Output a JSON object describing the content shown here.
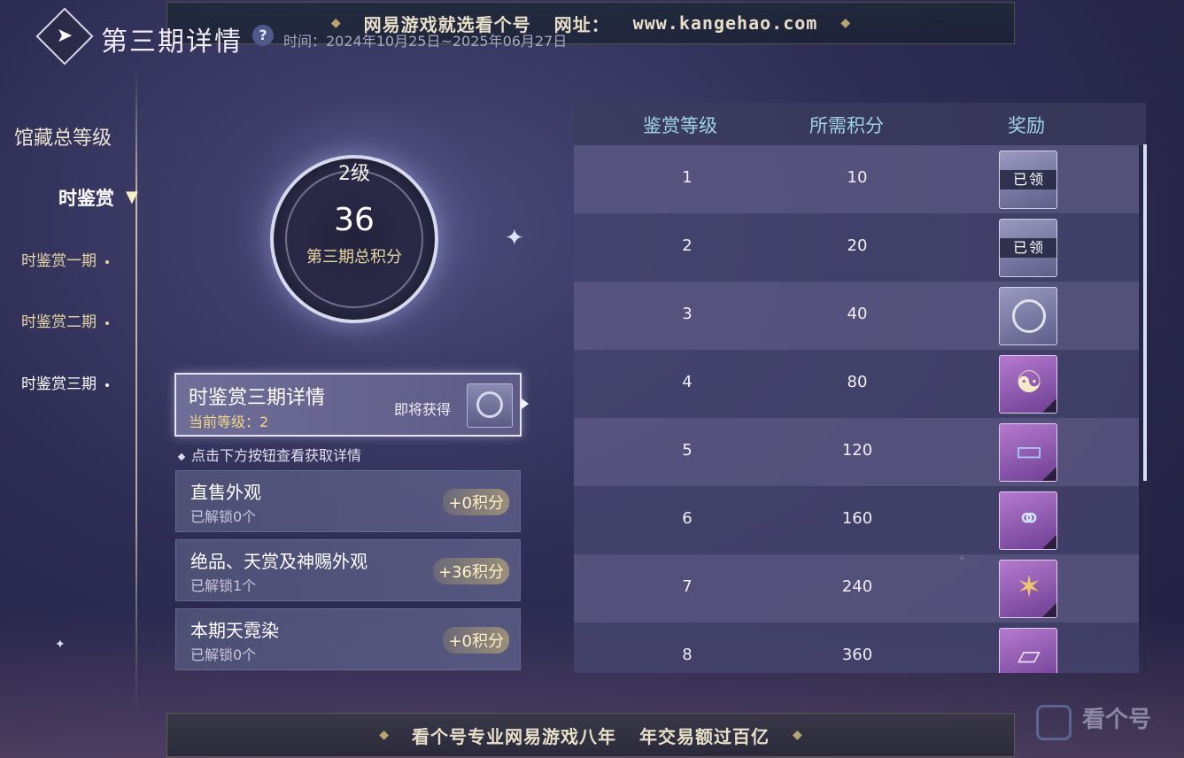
{
  "banner_top": {
    "text": "网易游戏就选看个号",
    "label": "网址：",
    "url": "www.kangehao.com"
  },
  "banner_bottom": {
    "left": "看个号专业网易游戏八年",
    "right": "年交易额过百亿"
  },
  "header": {
    "title": "第三期详情",
    "help_icon": "question-icon",
    "date_range": "时间：2024年10月25日~2025年06月27日"
  },
  "sidebar": {
    "total": "馆藏总等级",
    "section": "时鉴赏",
    "items": [
      {
        "label": "时鉴赏一期"
      },
      {
        "label": "时鉴赏二期"
      },
      {
        "label": "时鉴赏三期"
      }
    ]
  },
  "score": {
    "level": "2级",
    "points": "36",
    "label": "第三期总积分"
  },
  "detail": {
    "title": "时鉴赏三期详情",
    "current_level": "当前等级：2",
    "upcoming": "即将获得",
    "upcoming_reward_icon": "silver-ring-icon"
  },
  "hint": "点击下方按钮查看获取详情",
  "categories": [
    {
      "title": "直售外观",
      "unlocked": "已解锁0个",
      "points": "+0积分"
    },
    {
      "title": "绝品、天赏及神赐外观",
      "unlocked": "已解锁1个",
      "points": "+36积分"
    },
    {
      "title": "本期天霓染",
      "unlocked": "已解锁0个",
      "points": "+0积分"
    }
  ],
  "table": {
    "headers": [
      "鉴赏等级",
      "所需积分",
      "奖励"
    ],
    "rows": [
      {
        "level": "1",
        "points": "10",
        "reward": "silver-frame-icon",
        "claimed": "已领"
      },
      {
        "level": "2",
        "points": "20",
        "reward": "lantern-icon",
        "claimed": "已领"
      },
      {
        "level": "3",
        "points": "40",
        "reward": "silver-ring-icon",
        "claimed": ""
      },
      {
        "level": "4",
        "points": "80",
        "reward": "taiji-emblem-icon",
        "claimed": ""
      },
      {
        "level": "5",
        "points": "120",
        "reward": "blue-banner-icon",
        "claimed": ""
      },
      {
        "level": "6",
        "points": "160",
        "reward": "twin-figures-icon",
        "claimed": ""
      },
      {
        "level": "7",
        "points": "240",
        "reward": "martial-pose-icon",
        "claimed": ""
      },
      {
        "level": "8",
        "points": "360",
        "reward": "scroll-icon",
        "claimed": ""
      }
    ]
  },
  "watermark": {
    "text": "看个号"
  }
}
